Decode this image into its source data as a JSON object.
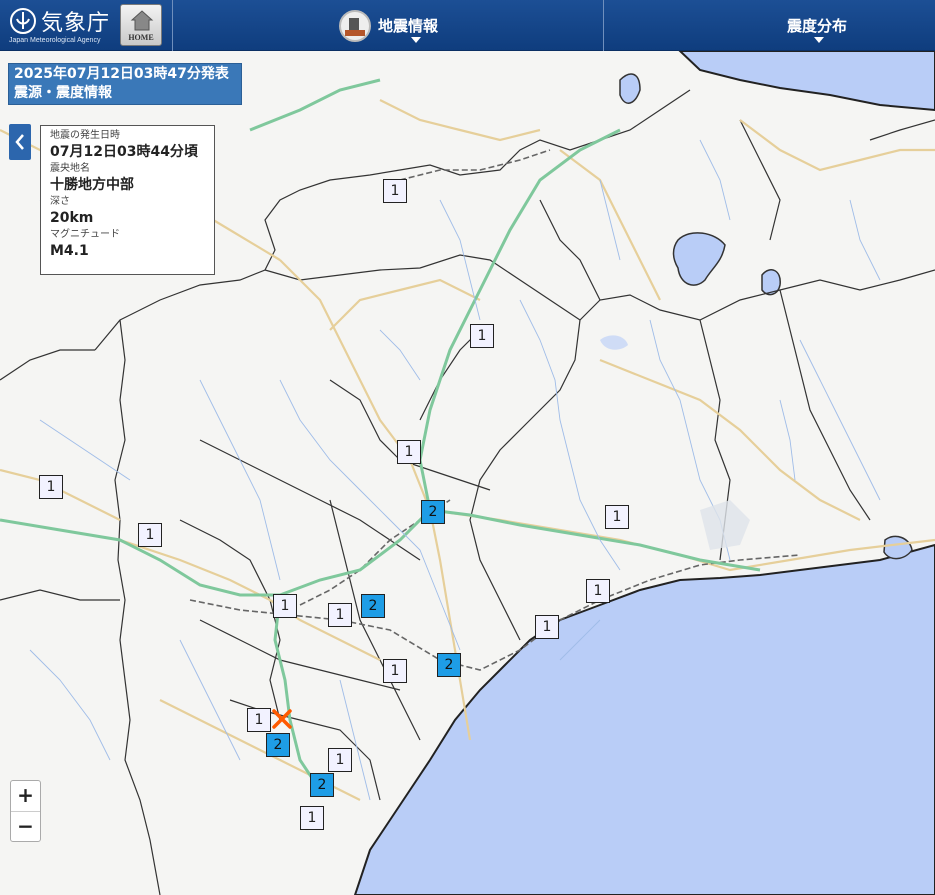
{
  "header": {
    "brand_ja": "気象庁",
    "brand_en": "Japan Meteorological Agency",
    "home_label": "HOME",
    "nav_earthquake": "地震情報",
    "nav_intensity": "震度分布"
  },
  "banner": {
    "line1": "2025年07月12日03時47分発表",
    "line2": "震源・震度情報"
  },
  "info": {
    "time_label": "地震の発生日時",
    "time_value": "07月12日03時44分頃",
    "region_label": "震央地名",
    "region_value": "十勝地方中部",
    "depth_label": "深さ",
    "depth_value": "20km",
    "magnitude_label": "マグニチュード",
    "magnitude_value": "M4.1"
  },
  "markers": [
    {
      "value": "1",
      "cls": "int-1"
    },
    {
      "value": "1",
      "cls": "int-1"
    },
    {
      "value": "1",
      "cls": "int-1"
    },
    {
      "value": "1",
      "cls": "int-1"
    },
    {
      "value": "1",
      "cls": "int-1"
    },
    {
      "value": "2",
      "cls": "int-2"
    },
    {
      "value": "1",
      "cls": "int-1"
    },
    {
      "value": "1",
      "cls": "int-1"
    },
    {
      "value": "1",
      "cls": "int-1"
    },
    {
      "value": "1",
      "cls": "int-1"
    },
    {
      "value": "2",
      "cls": "int-2"
    },
    {
      "value": "1",
      "cls": "int-1"
    },
    {
      "value": "1",
      "cls": "int-1"
    },
    {
      "value": "2",
      "cls": "int-2"
    },
    {
      "value": "1",
      "cls": "int-1"
    },
    {
      "value": "2",
      "cls": "int-2"
    },
    {
      "value": "1",
      "cls": "int-1"
    },
    {
      "value": "2",
      "cls": "int-2"
    },
    {
      "value": "1",
      "cls": "int-1"
    }
  ],
  "zoom": {
    "in": "+",
    "out": "−"
  },
  "colors": {
    "header": "#0f3d7e",
    "sea": "#b9cdf7",
    "land": "#f5f5f3",
    "intensity1": "#f2f2ff",
    "intensity2": "#1e9de6",
    "epicenter": "#ff5a00"
  }
}
